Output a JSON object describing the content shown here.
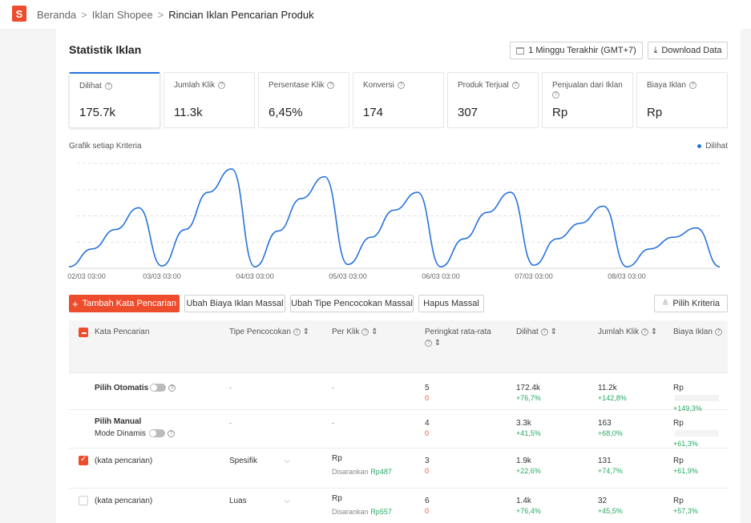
{
  "breadcrumb": {
    "items": [
      "Beranda",
      "Iklan Shopee",
      "Rincian Iklan Pencarian Produk"
    ],
    "sep": ">"
  },
  "logo": {
    "letter": "S"
  },
  "stats": {
    "title": "Statistik Iklan",
    "date_range": "1 Minggu Terakhir (GMT+7)",
    "download": "Download Data",
    "metrics": [
      {
        "label": "Dilihat",
        "value": "175.7k"
      },
      {
        "label": "Jumlah Klik",
        "value": "11.3k"
      },
      {
        "label": "Persentase Klik",
        "value": "6,45%"
      },
      {
        "label": "Konversi",
        "value": "174"
      },
      {
        "label": "Produk Terjual",
        "value": "307"
      },
      {
        "label": "Penjualan dari Iklan",
        "value": "Rp"
      },
      {
        "label": "Biaya Iklan",
        "value": "Rp"
      }
    ]
  },
  "chart_data": {
    "type": "line",
    "title": "Grafik setiap Kriteria",
    "legend": "top-right",
    "grid": true,
    "series": [
      {
        "name": "Dilihat",
        "color": "#2673dd",
        "x": [
          "02/03 03:00",
          "02/03 09:00",
          "02/03 15:00",
          "02/03 21:00",
          "03/03 03:00",
          "03/03 09:00",
          "03/03 15:00",
          "03/03 21:00",
          "04/03 03:00",
          "04/03 09:00",
          "04/03 15:00",
          "04/03 21:00",
          "05/03 03:00",
          "05/03 09:00",
          "05/03 15:00",
          "05/03 21:00",
          "06/03 03:00",
          "06/03 09:00",
          "06/03 15:00",
          "06/03 21:00",
          "07/03 03:00",
          "07/03 09:00",
          "07/03 15:00",
          "07/03 21:00",
          "08/03 03:00",
          "08/03 09:00",
          "08/03 15:00",
          "08/03 21:00",
          "09/03 03:00"
        ],
        "values": [
          2,
          25,
          50,
          78,
          3,
          50,
          98,
          128,
          2,
          48,
          90,
          118,
          5,
          40,
          75,
          98,
          2,
          38,
          72,
          98,
          4,
          38,
          58,
          80,
          2,
          25,
          40,
          52,
          2
        ]
      }
    ],
    "xticks": [
      "02/03 03:00",
      "03/03 03:00",
      "04/03 03:00",
      "05/03 03:00",
      "06/03 03:00",
      "07/03 03:00",
      "08/03 03:00"
    ]
  },
  "actions": {
    "add_keyword": "Tambah Kata Pencarian",
    "bulk_cost": "Ubah Biaya Iklan Massal",
    "bulk_match": "Ubah Tipe Pencocokan Massal",
    "bulk_delete": "Hapus Massal",
    "pick_criteria": "Pilih Kriteria"
  },
  "table": {
    "headers": [
      "Kata Pencarian",
      "Tipe Pencocokan",
      "Per Klik",
      "Peringkat rata-rata",
      "Dilihat",
      "Jumlah Klik",
      "Biaya Iklan"
    ],
    "rows": [
      {
        "keyword": "Pilih Otomatis",
        "match": "-",
        "per_click": "-",
        "rank": "5",
        "rank_delta": "0",
        "views": "172.4k",
        "views_delta": "+76,7%",
        "clicks": "11.2k",
        "clicks_delta": "+142,8%",
        "cost": "Rp",
        "cost_delta": "+149,3%"
      },
      {
        "keyword": "Pilih Manual",
        "sub": "Mode Dinamis",
        "match": "-",
        "per_click": "-",
        "rank": "4",
        "rank_delta": "0",
        "views": "3.3k",
        "views_delta": "+41,5%",
        "clicks": "163",
        "clicks_delta": "+68,0%",
        "cost": "Rp",
        "cost_delta": "+61,3%"
      },
      {
        "keyword": "(kata pencarian)",
        "match": "Spesifik",
        "per_click": "Rp",
        "suggest_label": "Disarankan",
        "suggest": "Rp487",
        "rank": "3",
        "rank_delta": "0",
        "views": "1.9k",
        "views_delta": "+22,6%",
        "clicks": "131",
        "clicks_delta": "+74,7%",
        "cost": "Rp",
        "cost_delta": "+61,9%"
      },
      {
        "keyword": "(kata pencarian)",
        "match": "Luas",
        "per_click": "Rp",
        "suggest_label": "Disarankan",
        "suggest": "Rp557",
        "rank": "6",
        "rank_delta": "0",
        "views": "1.4k",
        "views_delta": "+76,4%",
        "clicks": "32",
        "clicks_delta": "+45,5%",
        "cost": "Rp",
        "cost_delta": "+57,3%"
      }
    ]
  }
}
